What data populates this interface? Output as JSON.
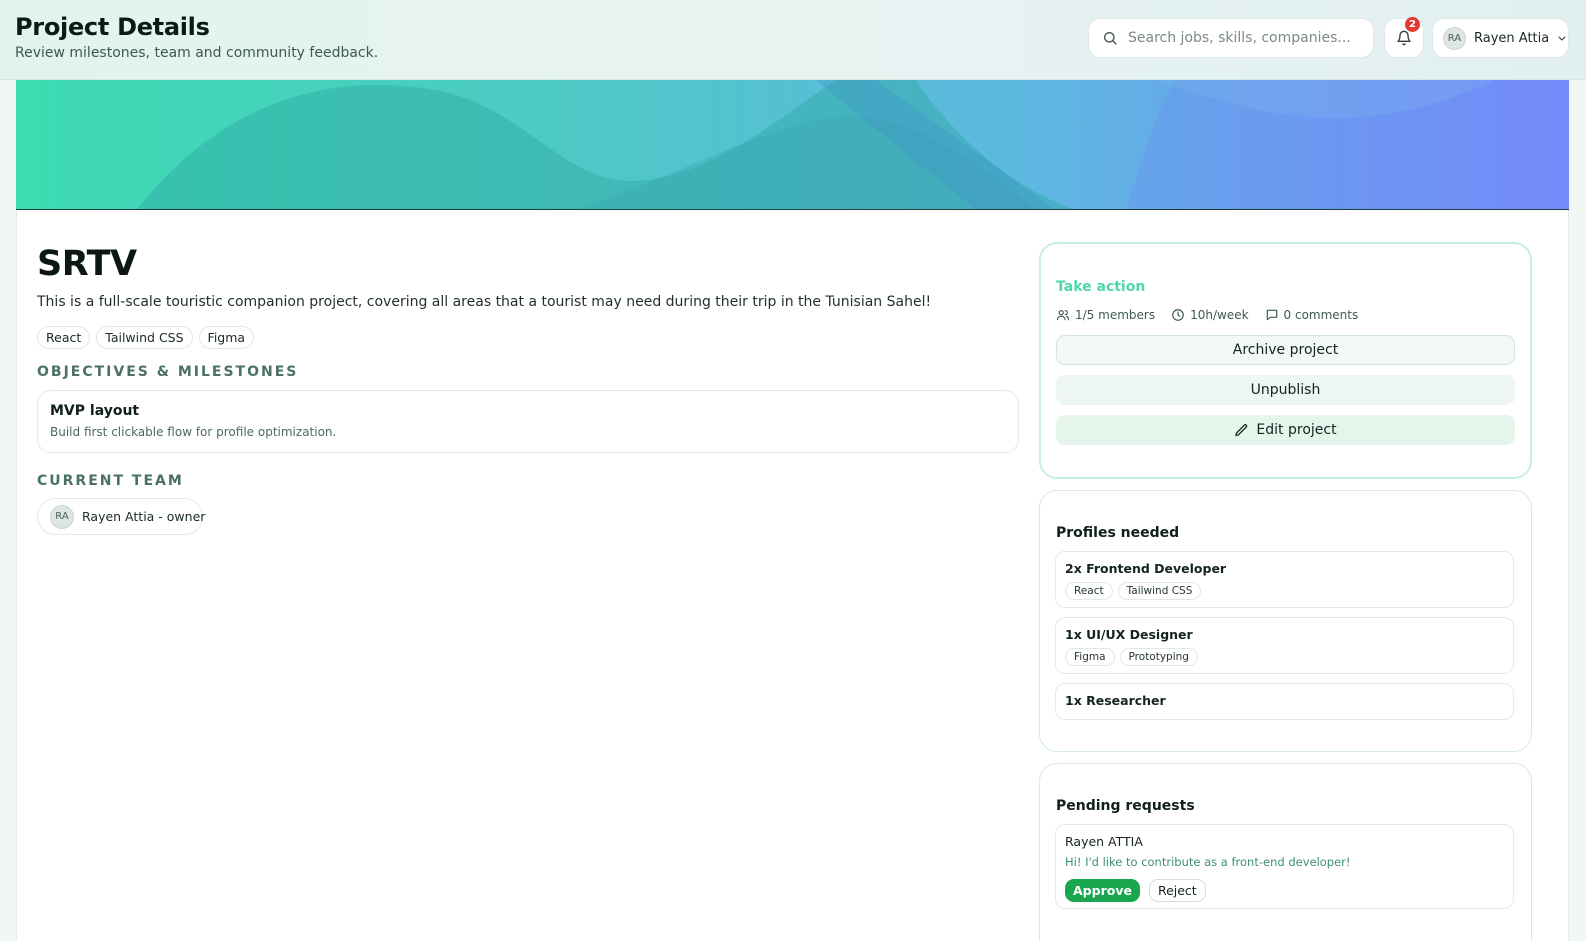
{
  "header": {
    "title": "Project Details",
    "subtitle": "Review milestones, team and community feedback.",
    "search_placeholder": "Search jobs, skills, companies...",
    "notification_count": "2",
    "user": {
      "initials": "RA",
      "name": "Rayen Attia"
    }
  },
  "project": {
    "title": "SRTV",
    "description": "This is a full-scale touristic companion project, covering all areas that a tourist may need during their trip in the Tunisian Sahel!",
    "tags": [
      "React",
      "Tailwind CSS",
      "Figma"
    ],
    "objectives_label": "OBJECTIVES & MILESTONES",
    "milestones": [
      {
        "title": "MVP layout",
        "description": "Build first clickable flow for profile optimization."
      }
    ],
    "team_label": "CURRENT TEAM",
    "team": [
      {
        "initials": "RA",
        "label": "Rayen Attia - owner"
      }
    ]
  },
  "action_card": {
    "heading": "Take action",
    "members": "1/5 members",
    "hours": "10h/week",
    "comments": "0 comments",
    "archive_label": "Archive project",
    "unpublish_label": "Unpublish",
    "edit_label": "Edit project"
  },
  "profiles_card": {
    "heading": "Profiles needed",
    "profiles": [
      {
        "title": "2x Frontend Developer",
        "tags": [
          "React",
          "Tailwind CSS"
        ]
      },
      {
        "title": "1x UI/UX Designer",
        "tags": [
          "Figma",
          "Prototyping"
        ]
      },
      {
        "title": "1x Researcher",
        "tags": []
      }
    ]
  },
  "pending_card": {
    "heading": "Pending requests",
    "requests": [
      {
        "name": "Rayen ATTIA",
        "message": "Hi! I'd like to contribute as a front-end developer!",
        "approve_label": "Approve",
        "reject_label": "Reject"
      }
    ]
  },
  "colors": {
    "accent": "#4fd7ac",
    "approve": "#1aa64f",
    "badge": "#e53935",
    "banner_start": "#3ddcb2",
    "banner_end": "#7b87ff"
  },
  "icons": {
    "search": "search-icon",
    "bell": "bell-icon",
    "chevron": "chevron-down-icon",
    "members": "users-icon",
    "clock": "clock-icon",
    "comments": "comment-icon",
    "edit": "pencil-icon"
  }
}
